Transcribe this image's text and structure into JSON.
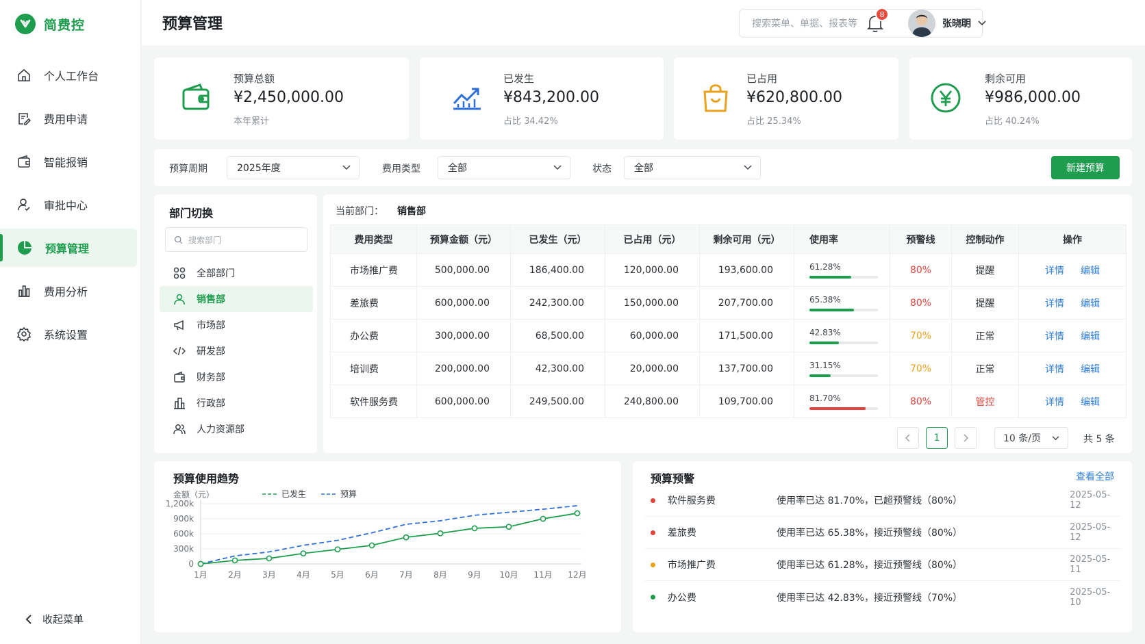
{
  "app": {
    "name": "简费控",
    "brand_color": "#1f9d4e"
  },
  "sidebar": {
    "items": [
      {
        "label": "个人工作台",
        "icon": "home-icon"
      },
      {
        "label": "费用申请",
        "icon": "document-edit-icon"
      },
      {
        "label": "智能报销",
        "icon": "wallet-icon"
      },
      {
        "label": "审批中心",
        "icon": "user-check-icon"
      },
      {
        "label": "预算管理",
        "icon": "pie-chart-icon",
        "active": true
      },
      {
        "label": "费用分析",
        "icon": "bar-chart-icon"
      },
      {
        "label": "系统设置",
        "icon": "gear-icon"
      }
    ],
    "collapse_label": "收起菜单"
  },
  "header": {
    "title": "预算管理",
    "search_placeholder": "搜索菜单、单据、报表等",
    "notifications": "8",
    "user_name": "张晓明"
  },
  "stats": [
    {
      "label": "预算总额",
      "value": "¥2,450,000.00",
      "sub": "本年累计",
      "icon": "wallet-icon",
      "color": "#1f9d4e"
    },
    {
      "label": "已发生",
      "value": "¥843,200.00",
      "sub": "占比 34.42%",
      "icon": "trend-up-icon",
      "color": "#2f6fd8"
    },
    {
      "label": "已占用",
      "value": "¥620,800.00",
      "sub": "占比 25.34%",
      "icon": "shopping-bag-icon",
      "color": "#e8a21b"
    },
    {
      "label": "剩余可用",
      "value": "¥986,000.00",
      "sub": "占比 40.24%",
      "icon": "yen-circle-icon",
      "color": "#1f9d4e"
    }
  ],
  "filters": {
    "period_label": "预算周期",
    "period_value": "2025年度",
    "type_label": "费用类型",
    "type_value": "全部",
    "status_label": "状态",
    "status_value": "全部",
    "new_button": "新建预算"
  },
  "departments": {
    "title": "部门切换",
    "search_placeholder": "搜索部门",
    "items": [
      {
        "label": "全部部门",
        "icon": "grid-icon"
      },
      {
        "label": "销售部",
        "icon": "user-icon",
        "active": true
      },
      {
        "label": "市场部",
        "icon": "megaphone-icon"
      },
      {
        "label": "研发部",
        "icon": "code-icon"
      },
      {
        "label": "财务部",
        "icon": "wallet-icon"
      },
      {
        "label": "行政部",
        "icon": "building-icon"
      },
      {
        "label": "人力资源部",
        "icon": "users-icon"
      }
    ]
  },
  "table": {
    "current_label": "当前部门：",
    "current_dept": "销售部",
    "headers": [
      "费用类型",
      "预算金额（元）",
      "已发生（元）",
      "已占用（元）",
      "剩余可用（元）",
      "使用率",
      "预警线",
      "控制动作",
      "操作"
    ],
    "rows": [
      {
        "type": "市场推广费",
        "budget": "500,000.00",
        "spent": "186,400.00",
        "occupied": "120,000.00",
        "remain": "193,600.00",
        "rate": "61.28%",
        "rate_value": 61.28,
        "rate_color": "#1f9d4e",
        "threshold": "80%",
        "threshold_color": "#e0443c",
        "action": "提醒",
        "action_color": "#30353a"
      },
      {
        "type": "差旅费",
        "budget": "600,000.00",
        "spent": "242,300.00",
        "occupied": "150,000.00",
        "remain": "207,700.00",
        "rate": "65.38%",
        "rate_value": 65.38,
        "rate_color": "#1f9d4e",
        "threshold": "80%",
        "threshold_color": "#e0443c",
        "action": "提醒",
        "action_color": "#30353a"
      },
      {
        "type": "办公费",
        "budget": "300,000.00",
        "spent": "68,500.00",
        "occupied": "60,000.00",
        "remain": "171,500.00",
        "rate": "42.83%",
        "rate_value": 42.83,
        "rate_color": "#1f9d4e",
        "threshold": "70%",
        "threshold_color": "#e8a21b",
        "action": "正常",
        "action_color": "#30353a"
      },
      {
        "type": "培训费",
        "budget": "200,000.00",
        "spent": "42,300.00",
        "occupied": "20,000.00",
        "remain": "137,700.00",
        "rate": "31.15%",
        "rate_value": 31.15,
        "rate_color": "#1f9d4e",
        "threshold": "70%",
        "threshold_color": "#e8a21b",
        "action": "正常",
        "action_color": "#30353a"
      },
      {
        "type": "软件服务费",
        "budget": "600,000.00",
        "spent": "249,500.00",
        "occupied": "240,800.00",
        "remain": "109,700.00",
        "rate": "81.70%",
        "rate_value": 81.7,
        "rate_color": "#e0443c",
        "threshold": "80%",
        "threshold_color": "#e0443c",
        "action": "管控",
        "action_color": "#e0443c"
      }
    ],
    "detail_label": "详情",
    "edit_label": "编辑",
    "pagination": {
      "page": "1",
      "page_size": "10 条/页",
      "total": "共 5 条"
    }
  },
  "trend": {
    "title": "预算使用趋势"
  },
  "chart_data": {
    "type": "line",
    "title": "预算使用趋势",
    "ylabel": "金额（元）",
    "categories": [
      "1月",
      "2月",
      "3月",
      "4月",
      "5月",
      "6月",
      "7月",
      "8月",
      "9月",
      "10月",
      "11月",
      "12月"
    ],
    "yticks": [
      "0",
      "300k",
      "600k",
      "900k",
      "1,200k"
    ],
    "ylim": [
      0,
      1200000
    ],
    "legend_position": "top",
    "series": [
      {
        "name": "已发生",
        "color": "#1f9d4e",
        "dashed": false,
        "markers": true,
        "values": [
          0,
          70000,
          110000,
          210000,
          290000,
          370000,
          530000,
          610000,
          710000,
          740000,
          900000,
          1010000
        ]
      },
      {
        "name": "预算",
        "color": "#2f6fd8",
        "dashed": true,
        "markers": false,
        "values": [
          0,
          160000,
          240000,
          370000,
          470000,
          620000,
          790000,
          860000,
          970000,
          1030000,
          1090000,
          1160000
        ]
      }
    ]
  },
  "warnings": {
    "title": "预算预警",
    "view_all": "查看全部",
    "items": [
      {
        "name": "软件服务费",
        "message": "使用率已达 81.70%，已超预警线（80%）",
        "date": "2025-05-12",
        "color": "#e0443c"
      },
      {
        "name": "差旅费",
        "message": "使用率已达 65.38%，接近预警线（80%）",
        "date": "2025-05-12",
        "color": "#e0443c"
      },
      {
        "name": "市场推广费",
        "message": "使用率已达 61.28%，接近预警线（80%）",
        "date": "2025-05-11",
        "color": "#e8a21b"
      },
      {
        "name": "办公费",
        "message": "使用率已达 42.83%，接近预警线（70%）",
        "date": "2025-05-10",
        "color": "#1f9d4e"
      }
    ]
  }
}
